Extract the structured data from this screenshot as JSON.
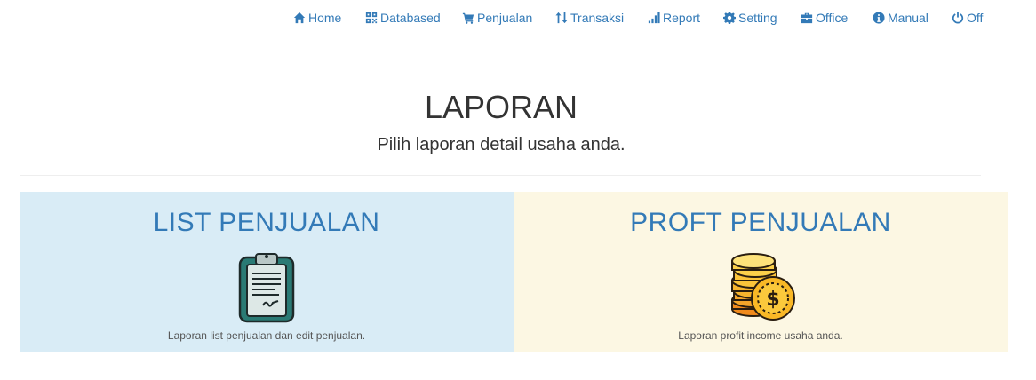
{
  "nav": {
    "items": [
      {
        "label": "Home",
        "icon": "home-icon"
      },
      {
        "label": "Databased",
        "icon": "qrcode-icon"
      },
      {
        "label": "Penjualan",
        "icon": "shopping-cart-icon"
      },
      {
        "label": "Transaksi",
        "icon": "sort-arrows-icon"
      },
      {
        "label": "Report",
        "icon": "signal-bars-icon"
      },
      {
        "label": "Setting",
        "icon": "gear-icon"
      },
      {
        "label": "Office",
        "icon": "briefcase-icon"
      },
      {
        "label": "Manual",
        "icon": "info-circle-icon"
      },
      {
        "label": "Off",
        "icon": "power-icon"
      }
    ]
  },
  "hero": {
    "title": "LAPORAN",
    "subtitle": "Pilih laporan detail usaha anda."
  },
  "panels": [
    {
      "title": "LIST PENJUALAN",
      "description": "Laporan list penjualan dan edit penjualan.",
      "icon": "clipboard-icon"
    },
    {
      "title": "PROFT PENJUALAN",
      "description": "Laporan profit income usaha anda.",
      "icon": "coins-icon"
    }
  ],
  "colors": {
    "link": "#337ab7",
    "panel_left_bg": "#d9ecf6",
    "panel_right_bg": "#fcf7e3"
  }
}
